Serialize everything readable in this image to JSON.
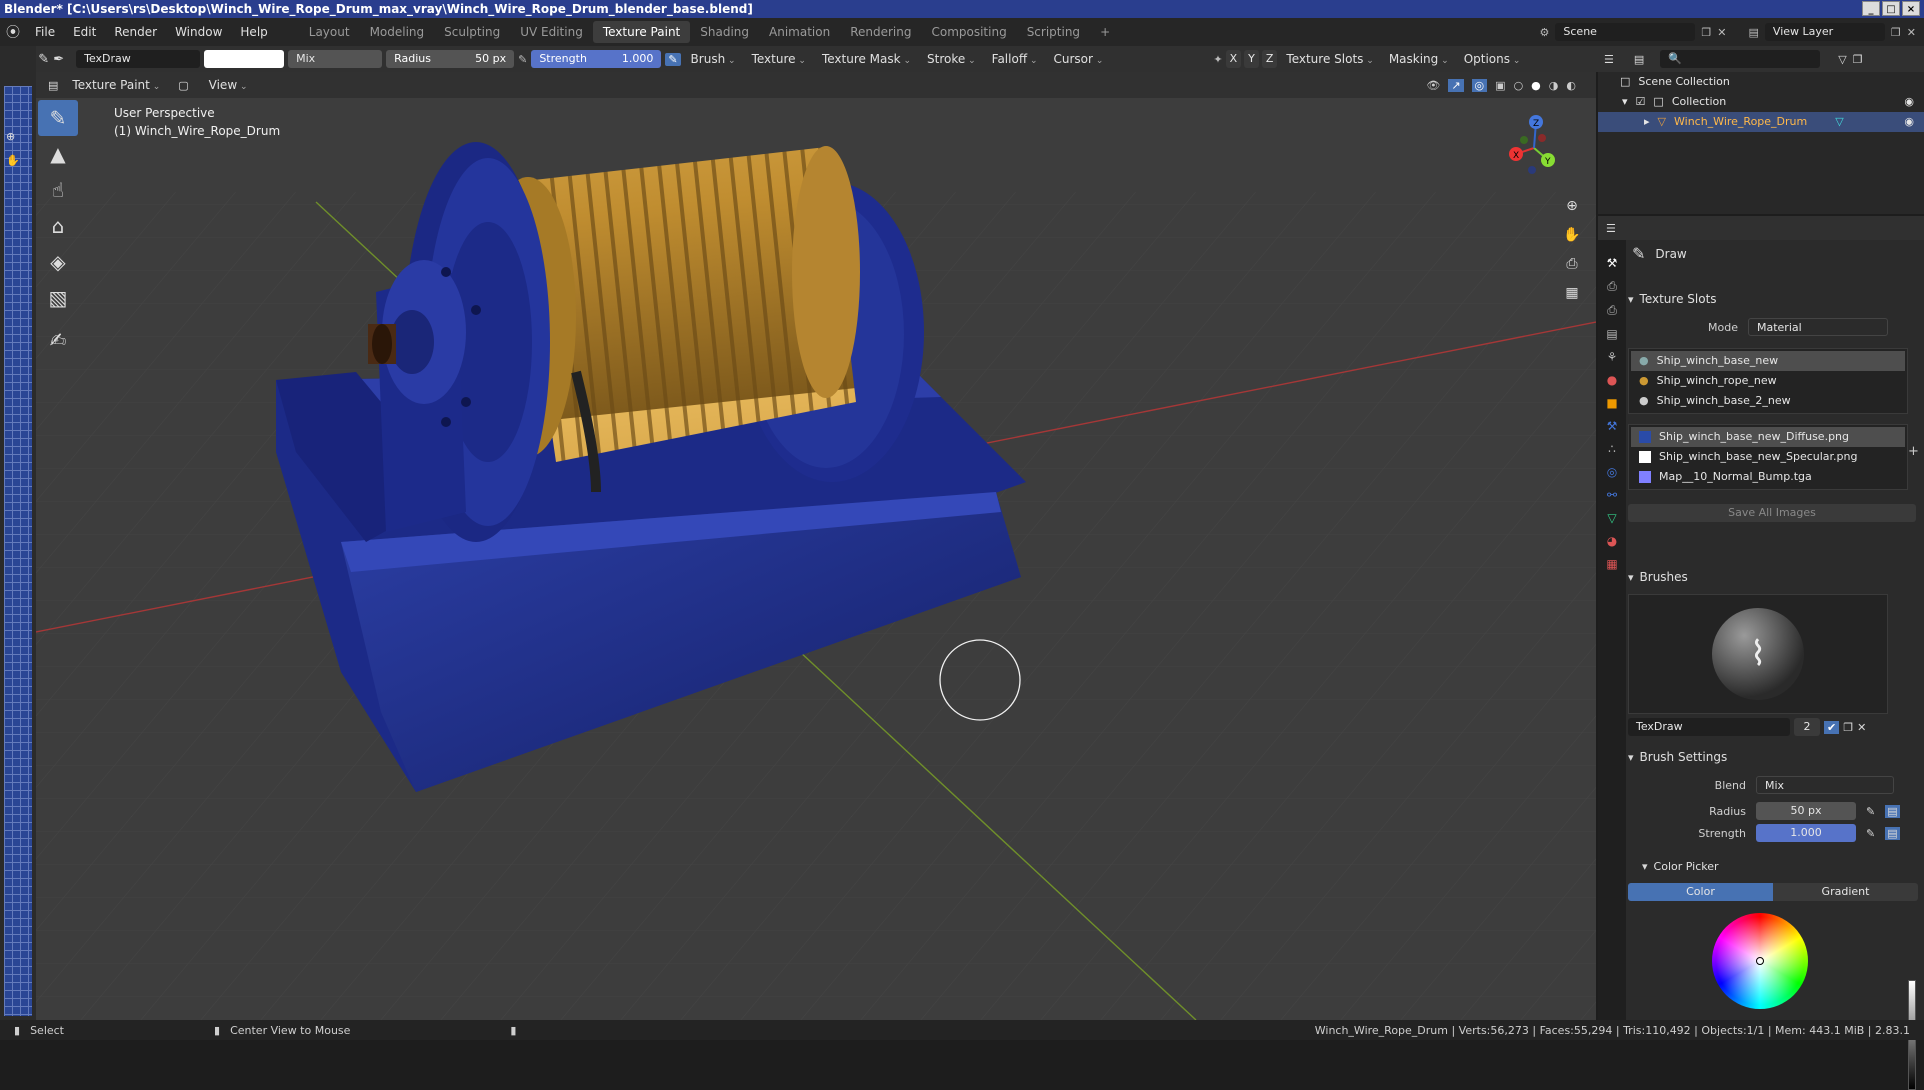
{
  "window": {
    "title": "Blender* [C:\\Users\\rs\\Desktop\\Winch_Wire_Rope_Drum_max_vray\\Winch_Wire_Rope_Drum_blender_base.blend]",
    "controls": [
      "_",
      "□",
      "×"
    ]
  },
  "menubar": {
    "items": [
      "File",
      "Edit",
      "Render",
      "Window",
      "Help"
    ],
    "workspaces": [
      "Layout",
      "Modeling",
      "Sculpting",
      "UV Editing",
      "Texture Paint",
      "Shading",
      "Animation",
      "Rendering",
      "Compositing",
      "Scripting"
    ],
    "active_workspace": "Texture Paint",
    "add_tab": "+",
    "scene": "Scene",
    "view_layer": "View Layer"
  },
  "toolheader": {
    "brush_name": "TexDraw",
    "blend": "Mix",
    "radius_label": "Radius",
    "radius_value": "50 px",
    "strength_label": "Strength",
    "strength_value": "1.000",
    "menus": [
      "Brush",
      "Texture",
      "Texture Mask",
      "Stroke",
      "Falloff",
      "Cursor"
    ],
    "axes": [
      "X",
      "Y",
      "Z"
    ],
    "right_menus": [
      "Texture Slots",
      "Masking",
      "Options"
    ]
  },
  "viewport_header": {
    "mode": "Texture Paint",
    "view": "View"
  },
  "viewport": {
    "perspective": "User Perspective",
    "object": "(1) Winch_Wire_Rope_Drum",
    "gizmo_axes": [
      "X",
      "Y",
      "Z"
    ]
  },
  "outliner": {
    "root": "Scene Collection",
    "collection": "Collection",
    "object": "Winch_Wire_Rope_Drum"
  },
  "properties": {
    "tool_name": "Draw",
    "texture_slots": {
      "title": "Texture Slots",
      "mode_label": "Mode",
      "mode_value": "Material",
      "materials": [
        "Ship_winch_base_new",
        "Ship_winch_rope_new",
        "Ship_winch_base_2_new"
      ],
      "images": [
        "Ship_winch_base_new_Diffuse.png",
        "Ship_winch_base_new_Specular.png",
        "Map__10_Normal_Bump.tga"
      ],
      "save_all": "Save All Images"
    },
    "brushes": {
      "title": "Brushes",
      "brush_name": "TexDraw",
      "users": "2"
    },
    "brush_settings": {
      "title": "Brush Settings",
      "blend_label": "Blend",
      "blend_value": "Mix",
      "radius_label": "Radius",
      "radius_value": "50 px",
      "strength_label": "Strength",
      "strength_value": "1.000",
      "color_picker": "Color Picker",
      "tab_color": "Color",
      "tab_gradient": "Gradient"
    }
  },
  "statusbar": {
    "select": "Select",
    "center": "Center View to Mouse",
    "stats": "Winch_Wire_Rope_Drum | Verts:56,273 | Faces:55,294 | Tris:110,492 | Objects:1/1 | Mem: 443.1 MiB | 2.83.1"
  },
  "colors": {
    "accent": "#4772b3",
    "drum_blue": "#1e2e8a",
    "rope_gold": "#c79a3a",
    "title_bar": "#2a3e8e"
  }
}
